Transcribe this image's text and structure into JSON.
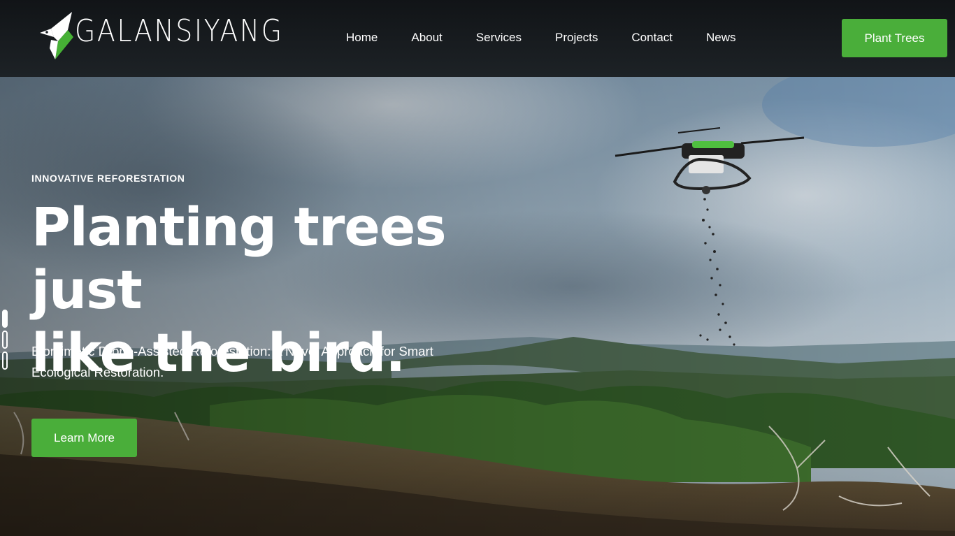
{
  "brand": {
    "name": "GALANSIYANG",
    "accent_color": "#4aae3a"
  },
  "nav": {
    "items": [
      {
        "label": "Home"
      },
      {
        "label": "About"
      },
      {
        "label": "Services"
      },
      {
        "label": "Projects"
      },
      {
        "label": "Contact"
      },
      {
        "label": "News"
      }
    ],
    "cta_label": "Plant Trees"
  },
  "hero": {
    "eyebrow": "INNOVATIVE REFORESTATION",
    "headline_line1": "Planting trees just",
    "headline_line2": "like the bird.",
    "subtitle": "Biomimetic Drone-Assisted Reforestation: A Novel Approach for Smart Ecological Restoration.",
    "button_label": "Learn More",
    "slide_count": 3,
    "active_slide": 1
  }
}
